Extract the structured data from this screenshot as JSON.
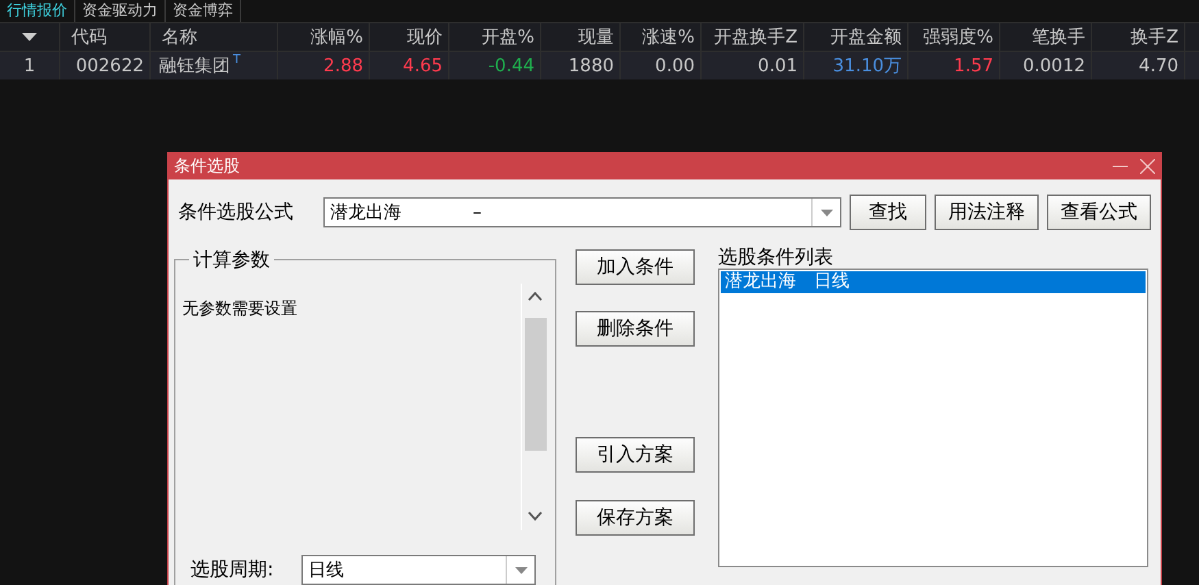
{
  "tabs": [
    {
      "label": "行情报价",
      "selected": true
    },
    {
      "label": "资金驱动力",
      "selected": false
    },
    {
      "label": "资金博弈",
      "selected": false
    }
  ],
  "table": {
    "columns": [
      "代码",
      "名称",
      "涨幅%",
      "现价",
      "开盘%",
      "现量",
      "涨速%",
      "开盘换手Z",
      "开盘金额",
      "强弱度%",
      "笔换手",
      "换手Z"
    ],
    "rows": [
      {
        "index": "1",
        "selected": true,
        "cells": [
          {
            "text": "002622",
            "color": "#c8c8c8"
          },
          {
            "text": "融钰集团",
            "color": "#c8c8c8",
            "badge": "T"
          },
          {
            "text": "2.88",
            "color": "#ff3b4e"
          },
          {
            "text": "4.65",
            "color": "#ff3b4e"
          },
          {
            "text": "-0.44",
            "color": "#1fae4e"
          },
          {
            "text": "1880",
            "color": "#c8c8c8"
          },
          {
            "text": "0.00",
            "color": "#c8c8c8"
          },
          {
            "text": "0.01",
            "color": "#c8c8c8"
          },
          {
            "text": "31.10万",
            "color": "#4a8fe0"
          },
          {
            "text": "1.57",
            "color": "#ff3b4e"
          },
          {
            "text": "0.0012",
            "color": "#c8c8c8"
          },
          {
            "text": "4.70",
            "color": "#c8c8c8"
          }
        ]
      }
    ]
  },
  "dialog": {
    "title": "条件选股",
    "formula_label": "条件选股公式",
    "formula_value": "潜龙出海　　　　–",
    "top_buttons": [
      "查找",
      "用法注释",
      "查看公式"
    ],
    "params": {
      "title": "计算参数",
      "message": "无参数需要设置"
    },
    "middle_buttons": [
      "加入条件",
      "删除条件",
      "引入方案",
      "保存方案"
    ],
    "period": {
      "label": "选股周期:",
      "value": "日线"
    },
    "conditions": {
      "title": "选股条件列表",
      "items": [
        {
          "label": "潜龙出海　日线",
          "selected": true
        }
      ]
    }
  }
}
